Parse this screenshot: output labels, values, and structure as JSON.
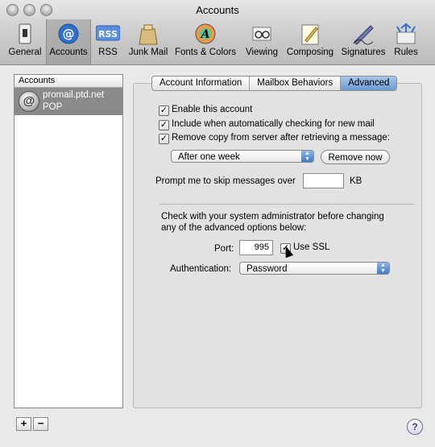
{
  "window": {
    "title": "Accounts"
  },
  "toolbar": {
    "items": [
      {
        "label": "General",
        "icon": "switch-icon"
      },
      {
        "label": "Accounts",
        "icon": "at-sign-icon"
      },
      {
        "label": "RSS",
        "icon": "rss-icon"
      },
      {
        "label": "Junk Mail",
        "icon": "junk-mail-bag-icon"
      },
      {
        "label": "Fonts & Colors",
        "icon": "font-color-wheel-icon"
      },
      {
        "label": "Viewing",
        "icon": "glasses-icon"
      },
      {
        "label": "Composing",
        "icon": "pencil-notepad-icon"
      },
      {
        "label": "Signatures",
        "icon": "signature-pen-icon"
      },
      {
        "label": "Rules",
        "icon": "rules-arrows-icon"
      }
    ],
    "selected": "Accounts"
  },
  "sidebar": {
    "header": "Accounts",
    "accounts": [
      {
        "name": "promail.ptd.net",
        "type": "POP",
        "selected": true
      }
    ],
    "add_label": "+",
    "remove_label": "−"
  },
  "tabs": {
    "items": [
      "Account Information",
      "Mailbox Behaviors",
      "Advanced"
    ],
    "active": "Advanced"
  },
  "advanced": {
    "enable_account": {
      "label": "Enable this account",
      "checked": true
    },
    "include_check": {
      "label": "Include when automatically checking for new mail",
      "checked": true
    },
    "remove_copy": {
      "label": "Remove copy from server after retrieving a message:",
      "checked": true
    },
    "remove_when": "After one week",
    "remove_now_label": "Remove now",
    "prompt_label": "Prompt me to skip messages over",
    "prompt_value": "",
    "prompt_unit": "KB",
    "admin_note_line1": "Check with your system administrator before changing",
    "admin_note_line2": "any of the advanced options below:",
    "port_label": "Port:",
    "port_value": "995",
    "use_ssl": {
      "label": "Use SSL",
      "checked": true
    },
    "auth_label": "Authentication:",
    "auth_value": "Password"
  },
  "help_label": "?",
  "check_mark": "✓",
  "colors": {
    "tab_active": "#6b9ad4",
    "selection": "#8a8a8a"
  }
}
